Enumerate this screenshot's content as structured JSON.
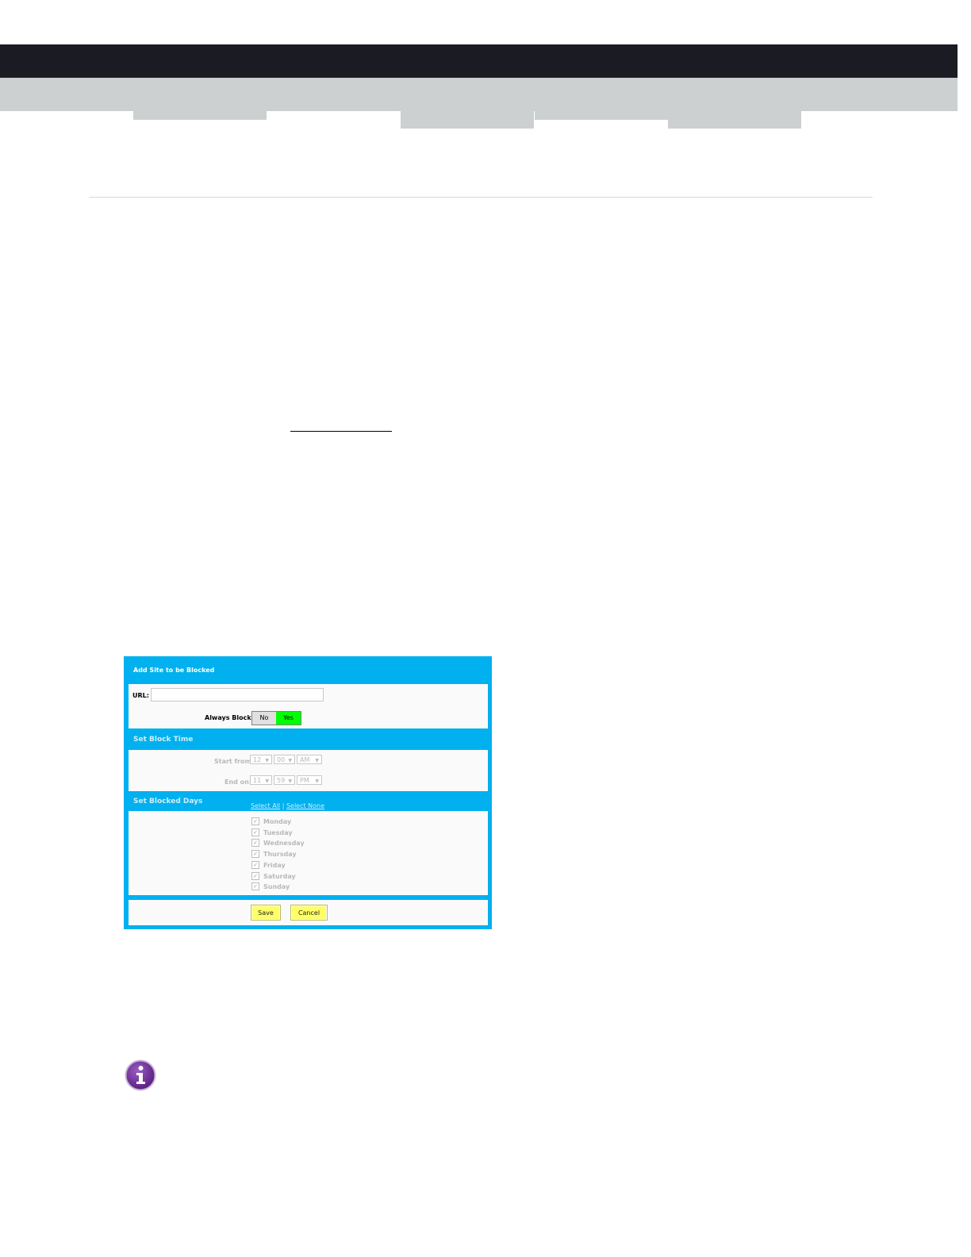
{
  "panel": {
    "title": "Add Site to be Blocked",
    "url_label": "URL:",
    "url_value": "",
    "always_block_label": "Always Block?",
    "toggle_no": "No",
    "toggle_yes": "Yes",
    "toggle_selected": "Yes"
  },
  "block_time": {
    "heading": "Set Block Time",
    "start_label": "Start from:",
    "start_hour": "12",
    "start_minute": "00",
    "start_ampm": "AM",
    "end_label": "End on:",
    "end_hour": "11",
    "end_minute": "59",
    "end_ampm": "PM"
  },
  "blocked_days": {
    "heading": "Set Blocked Days",
    "select_all": "Select All",
    "separator": "|",
    "select_none": "Select None",
    "days": [
      {
        "label": "Monday",
        "checked": true
      },
      {
        "label": "Tuesday",
        "checked": true
      },
      {
        "label": "Wednesday",
        "checked": true
      },
      {
        "label": "Thursday",
        "checked": true
      },
      {
        "label": "Friday",
        "checked": true
      },
      {
        "label": "Saturday",
        "checked": true
      },
      {
        "label": "Sunday",
        "checked": true
      }
    ]
  },
  "actions": {
    "save": "Save",
    "cancel": "Cancel"
  },
  "icons": {
    "note": "info-icon"
  },
  "colors": {
    "header_bar": "#1b1c23",
    "nav_band": "#cdd0d1",
    "panel_blue": "#00b0ef",
    "toggle_on": "#00ff00",
    "button_yellow": "#ffff66",
    "info_purple": "#6b2c91"
  }
}
